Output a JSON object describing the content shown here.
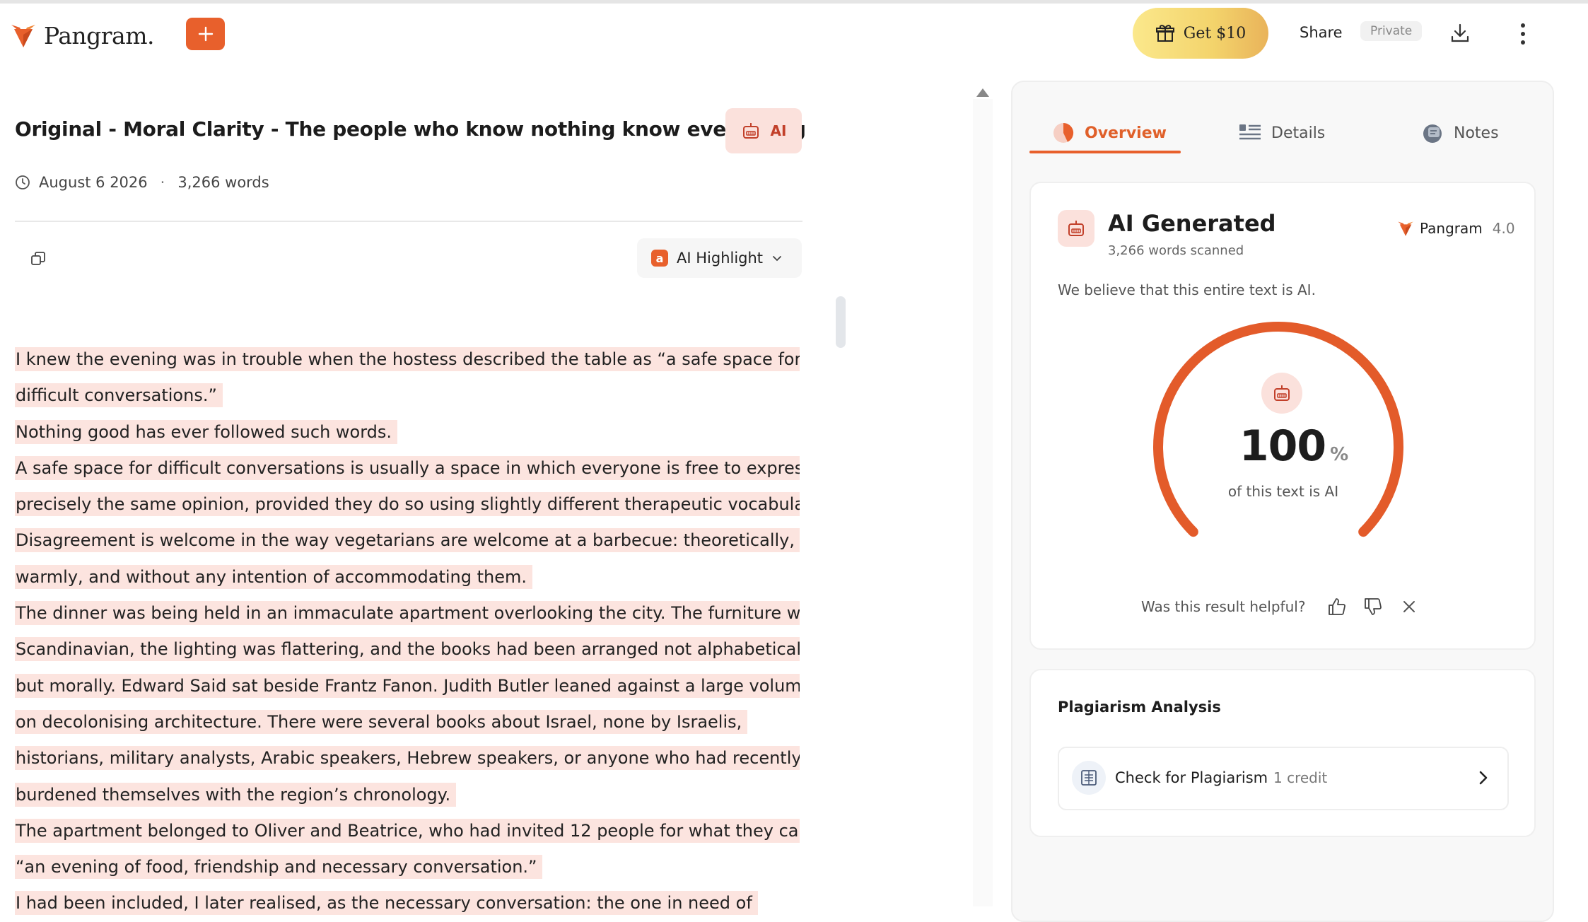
{
  "header": {
    "logo_text": "Pangram.",
    "promo_label": "Get $10",
    "share_label": "Share",
    "privacy_badge": "Private"
  },
  "document": {
    "title": "Original - Moral Clarity - The people who know nothing know everything",
    "verdict_badge": "AI",
    "date": "August 6 2026",
    "word_count": "3,266 words",
    "highlight_mode": "AI Highlight",
    "lines": [
      "I knew the evening was in trouble when the hostess described the table as “a safe space for",
      "difficult conversations.”",
      "Nothing good has ever followed such words.",
      "A safe space for difficult conversations is usually a space in which everyone is free to express",
      "precisely the same opinion, provided they do so using slightly different therapeutic vocabulary.",
      "Disagreement is welcome in the way vegetarians are welcome at a barbecue: theoretically,",
      "warmly, and without any intention of accommodating them.",
      "The dinner was being held in an immaculate apartment overlooking the city. The furniture was",
      "Scandinavian, the lighting was flattering, and the books had been arranged not alphabetically",
      "but morally. Edward Said sat beside Frantz Fanon. Judith Butler leaned against a large volume",
      "on decolonising architecture. There were several books about Israel, none by Israelis,",
      "historians, military analysts, Arabic speakers, Hebrew speakers, or anyone who had recently",
      "burdened themselves with the region’s chronology.",
      "The apartment belonged to Oliver and Beatrice, who had invited 12 people for what they called",
      "“an evening of food, friendship and necessary conversation.”",
      "I had been included, I later realised, as the necessary conversation: the one in need of"
    ]
  },
  "panel": {
    "tabs": [
      "Overview",
      "Details",
      "Notes"
    ],
    "active_tab": "Overview",
    "result": {
      "title": "AI Generated",
      "words_scanned": "3,266 words scanned",
      "model_name": "Pangram",
      "model_version": "4.0",
      "belief": "We believe that this entire text is AI.",
      "percentage": "100",
      "percent_sign": "%",
      "percentage_fraction": 1.0,
      "caption": "of this text is AI",
      "helpful_prompt": "Was this result helpful?"
    },
    "plagiarism": {
      "title": "Plagiarism Analysis",
      "button_label": "Check for Plagiarism",
      "cost": "1 credit"
    }
  },
  "colors": {
    "accent": "#e8602c",
    "highlight": "#fce4df",
    "badge_bg": "#fbe1dc"
  },
  "icons": [
    "fox-logo-icon",
    "plus-icon",
    "gift-icon",
    "download-icon",
    "kebab-menu-icon",
    "clock-icon",
    "robot-icon",
    "copy-icon",
    "chevron-down-icon",
    "pie-icon",
    "list-icon",
    "notes-icon",
    "thumbs-up-icon",
    "thumbs-down-icon",
    "close-icon",
    "document-scan-icon",
    "chevron-right-icon"
  ]
}
